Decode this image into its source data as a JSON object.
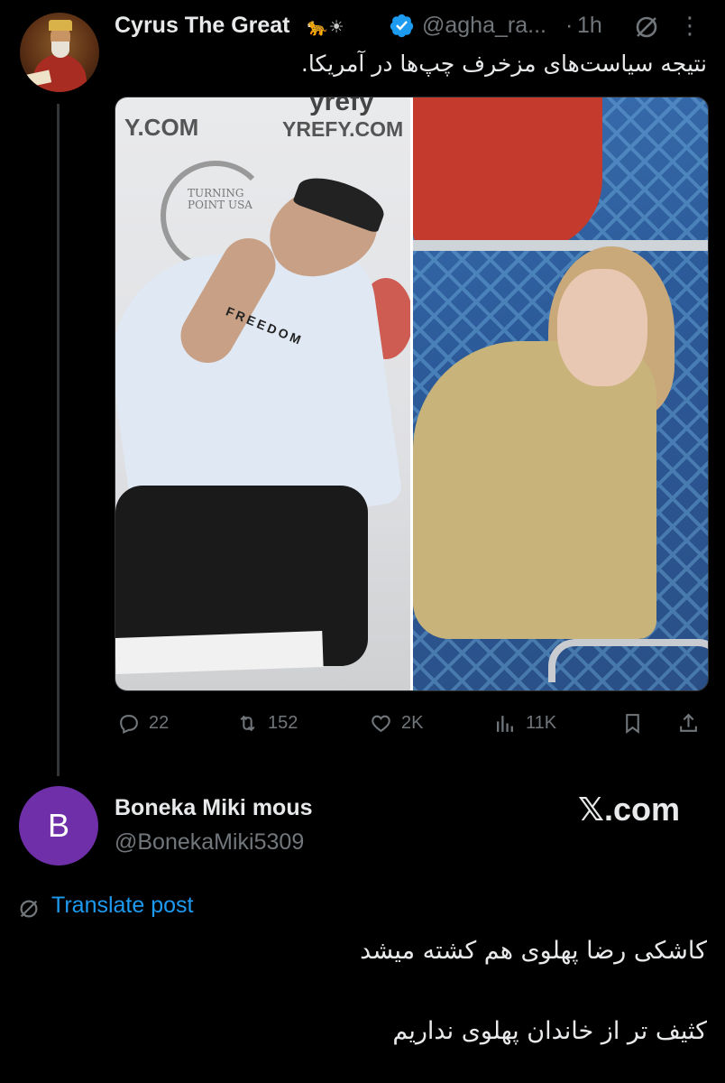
{
  "post": {
    "author_name": "Cyrus The Great",
    "name_emojis": "🐆☀",
    "handle": "@agha_ra...",
    "separator": "·",
    "time": "1h",
    "text": "نتیجه سیاست‌های مزخرف چپ‌ها در آمریکا.",
    "media": {
      "left_watermark_1": "Y.COM",
      "left_watermark_2": "YREFY.COM",
      "left_watermark_3": "yrefy",
      "left_logo_text": "TURNING POINT USA",
      "left_shirt_text": "FREEDOM"
    },
    "actions": {
      "replies": "22",
      "reposts": "152",
      "likes": "2K",
      "views": "11K"
    }
  },
  "reply": {
    "avatar_letter": "B",
    "author_name": "Boneka Miki mous",
    "handle": "@BonekaMiki5309",
    "watermark": "𝕏.com",
    "translate_label": "Translate post",
    "line1": "کاشکی رضا پهلوی هم کشته میشد",
    "line2": "کثیف تر از خاندان پهلوی نداریم"
  },
  "colors": {
    "background": "#000000",
    "text": "#e7e9ea",
    "muted": "#71767b",
    "link": "#1d9bf0",
    "verified": "#1d9bf0",
    "avatar2_bg": "#6e2fa8"
  }
}
